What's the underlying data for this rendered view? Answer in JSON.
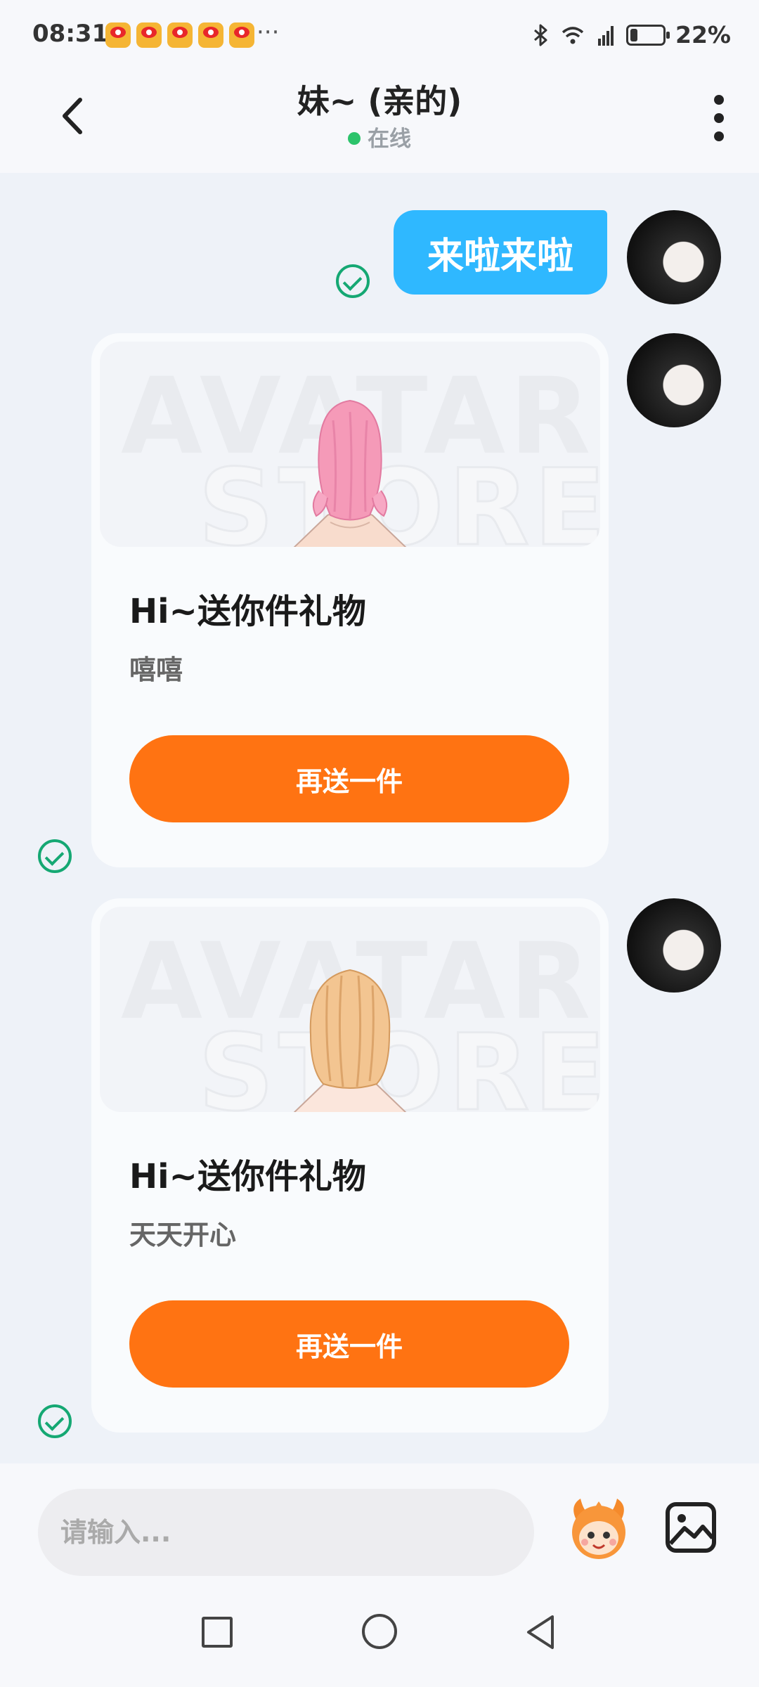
{
  "status_bar": {
    "time": "08:31",
    "more_indicator": "···",
    "battery_percent": "22%",
    "battery_level": 0.22,
    "notification_icons": [
      "weibo-icon",
      "weibo-icon",
      "weibo-icon",
      "weibo-icon",
      "weibo-icon"
    ]
  },
  "header": {
    "title": "妹~ (亲的)",
    "presence": "在线",
    "back_icon": "chevron-left-icon",
    "menu_icon": "more-vertical-icon"
  },
  "chat": {
    "messages": [
      {
        "type": "text",
        "text": "来啦来啦",
        "status_icon": "sent-check-icon"
      },
      {
        "type": "gift",
        "banner_watermark": [
          "AVATAR",
          "STORE"
        ],
        "title": "Hi~送你件礼物",
        "message": "嘻嘻",
        "button": "再送一件",
        "status_icon": "sent-check-icon"
      },
      {
        "type": "gift",
        "banner_watermark": [
          "AVATAR",
          "STORE"
        ],
        "title": "Hi~送你件礼物",
        "message": "天天开心",
        "button": "再送一件",
        "status_icon": "sent-check-icon"
      }
    ]
  },
  "input_bar": {
    "placeholder": "请输入...",
    "value": "",
    "mascot_icon": "mascot-sticker-icon",
    "image_icon": "image-icon"
  },
  "nav_bar": {
    "icons": [
      "recents-square-icon",
      "home-circle-icon",
      "back-triangle-icon"
    ]
  },
  "colors": {
    "bubble": "#2fb8ff",
    "button": "#ff7312",
    "check": "#15a873",
    "online": "#2cc36b",
    "chat_background": "#eef2f8"
  }
}
